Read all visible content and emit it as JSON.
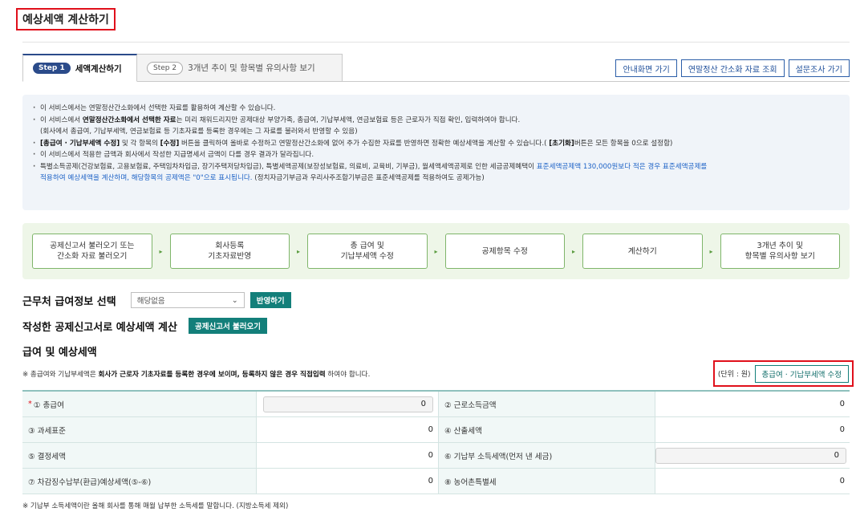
{
  "page": {
    "title": "예상세액 계산하기"
  },
  "tabs": [
    {
      "step": "Step 1",
      "label": "세액계산하기"
    },
    {
      "step": "Step 2",
      "label": "3개년 추이 및 항목별 유의사항 보기"
    }
  ],
  "top_buttons": [
    "안내화면 가기",
    "연말정산 간소화 자료 조회",
    "설문조사 가기"
  ],
  "notice": {
    "l1": "이 서비스에서는 연말정산간소화에서 선택한 자료를 활용하여 계산할 수 있습니다.",
    "l2a": "이 서비스에서 ",
    "l2b": "연말정산간소화에서 선택한 자료",
    "l2c": "는 미리 채워드리지만 공제대상 부양가족, 총급여, 기납부세액, 연금보험료 등은 근로자가 직접 확인, 입력하여야 합니다.",
    "l3": "(회사에서 총급여, 기납부세액, 연금보험료 등 기초자료를 등록한 경우에는 그 자료를 불러와서 반영할 수 있음)",
    "l4a": "[총급여 · 기납부세액 수정]",
    "l4b": " 및 각 항목의 ",
    "l4c": "[수정]",
    "l4d": " 버튼을 클릭하여 올바로 수정하고 연말정산간소화에 없어 추가 수집한 자료를 반영하면 정확한 예상세액을 계산할 수 있습니다.( ",
    "l4e": "[초기화]",
    "l4f": "버튼은 모든 항목을 0으로 설정함)",
    "l5": "이 서비스에서 적용한 금액과 회사에서 작성한 지급명세서 금액이 다를 경우 결과가 달라집니다.",
    "l6a": "특별소득공제(건강보험료, 고용보험료, 주택임차차입금, 장기주택저당차입금), 특별세액공제(보장성보험료, 의료비, 교육비, 기부금), 월세액세액공제로 인한 세금공제혜택이 ",
    "l6b": "표준세액공제액 130,000원보다 적은 경우 표준세액공제를",
    "l7a": "적용하여 예상세액을 계산하며, 해당항목의 공제액은 \"0\"으로 표시됩니다.",
    "l7b": " (정치자금기부금과 우리사주조합기부금은 표준세액공제를 적용하여도 공제가능)"
  },
  "flow_steps": [
    "공제신고서 불러오기 또는\n간소화 자료 불러오기",
    "회사등록\n기초자료반영",
    "총 급여 및\n기납부세액 수정",
    "공제항목 수정",
    "계산하기",
    "3개년 추이 및\n항목별 유의사항 보기"
  ],
  "flow_arrow": "▸",
  "workplace": {
    "label": "근무처 급여정보 선택",
    "select_value": "해당없음",
    "select_arrow": "⌄",
    "apply_button": "반영하기"
  },
  "deduction": {
    "label": "작성한 공제신고서로 예상세액 계산",
    "load_button": "공제신고서 불러오기"
  },
  "salary": {
    "label": "급여 및 예상세액",
    "note_a": "※ 총급여와 기납부세액은 ",
    "note_b": "회사가 근로자 기초자료를 등록한 경우에 보이며, 등록하지 않은 경우 직접입력",
    "note_c": " 하여야 합니다.",
    "unit": "(단위 : 원)",
    "edit_button": "총급여 · 기납부세액 수정",
    "rows": [
      {
        "l_label": "① 총급여",
        "l_value": "0",
        "r_label": "② 근로소득금액",
        "r_value": "0"
      },
      {
        "l_label": "③ 과세표준",
        "l_value": "0",
        "r_label": "④ 산출세액",
        "r_value": "0"
      },
      {
        "l_label": "⑤ 결정세액",
        "l_value": "0",
        "r_label": "⑥ 기납부 소득세액(먼저 낸 세금)",
        "r_value": "0"
      },
      {
        "l_label": "⑦ 차감징수납부(환급)예상세액(⑤-⑥)",
        "l_value": "0",
        "r_label": "⑧ 농어촌특별세",
        "r_value": "0"
      }
    ],
    "required_mark": "*",
    "footnote": "※ 기납부 소득세액이란 올해 회사를 통해 매월 납부한 소득세를 말합니다. (지방소득세 제외)"
  },
  "colors": {
    "accent": "#137f7a",
    "navy": "#2b4b8a",
    "highlight": "#e0101b"
  }
}
